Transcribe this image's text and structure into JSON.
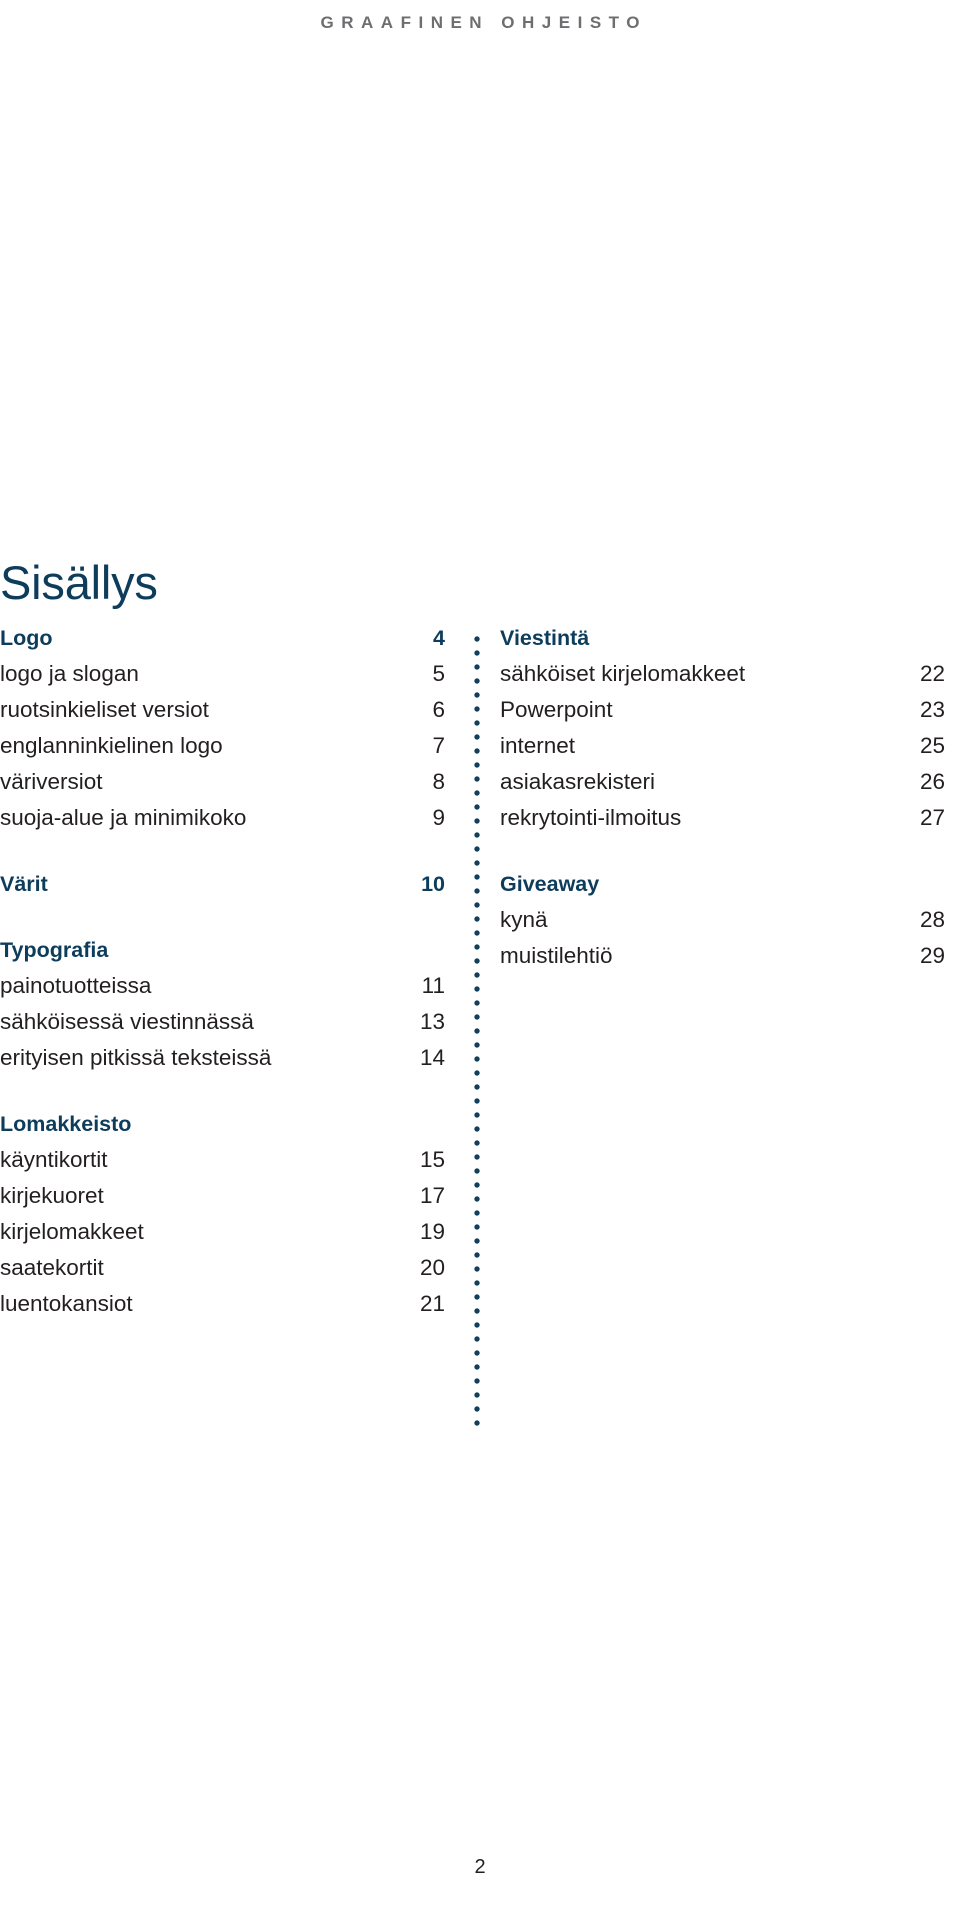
{
  "header": {
    "text": "GRAAFINEN OHJEISTO",
    "color": "#6d6e70"
  },
  "title": "Sisällys",
  "colors": {
    "navy": "#0e3d5c",
    "body_text": "#231f20",
    "header_gray": "#6d6e70",
    "divider_dot": "#123f5c"
  },
  "toc": {
    "left_column": [
      {
        "heading": {
          "label": "Logo",
          "page": "4"
        },
        "entries": [
          {
            "label": "logo ja slogan",
            "page": "5"
          },
          {
            "label": "ruotsinkieliset versiot",
            "page": "6"
          },
          {
            "label": "englanninkielinen logo",
            "page": "7"
          },
          {
            "label": "väriversiot",
            "page": "8"
          },
          {
            "label": "suoja-alue ja minimikoko",
            "page": "9"
          }
        ]
      },
      {
        "heading": {
          "label": "Värit",
          "page": "10"
        },
        "entries": []
      },
      {
        "heading": {
          "label": "Typografia",
          "page": ""
        },
        "entries": [
          {
            "label": "painotuotteissa",
            "page": "11"
          },
          {
            "label": "sähköisessä viestinnässä",
            "page": "13"
          },
          {
            "label": "erityisen pitkissä teksteissä",
            "page": "14"
          }
        ]
      },
      {
        "heading": {
          "label": "Lomakkeisto",
          "page": ""
        },
        "entries": [
          {
            "label": "käyntikortit",
            "page": "15"
          },
          {
            "label": "kirjekuoret",
            "page": "17"
          },
          {
            "label": "kirjelomakkeet",
            "page": "19"
          },
          {
            "label": "saatekortit",
            "page": "20"
          },
          {
            "label": "luentokansiot",
            "page": "21"
          }
        ]
      }
    ],
    "right_column": [
      {
        "heading": {
          "label": "Viestintä",
          "page": ""
        },
        "entries": [
          {
            "label": "sähköiset kirjelomakkeet",
            "page": "22"
          },
          {
            "label": "Powerpoint",
            "page": "23"
          },
          {
            "label": "internet",
            "page": "25"
          },
          {
            "label": "asiakasrekisteri",
            "page": "26"
          },
          {
            "label": "rekrytointi-ilmoitus",
            "page": "27"
          }
        ]
      },
      {
        "heading": {
          "label": "Giveaway",
          "page": ""
        },
        "entries": [
          {
            "label": "kynä",
            "page": "28"
          },
          {
            "label": "muistilehtiö",
            "page": "29"
          }
        ]
      }
    ]
  },
  "folio": "2"
}
